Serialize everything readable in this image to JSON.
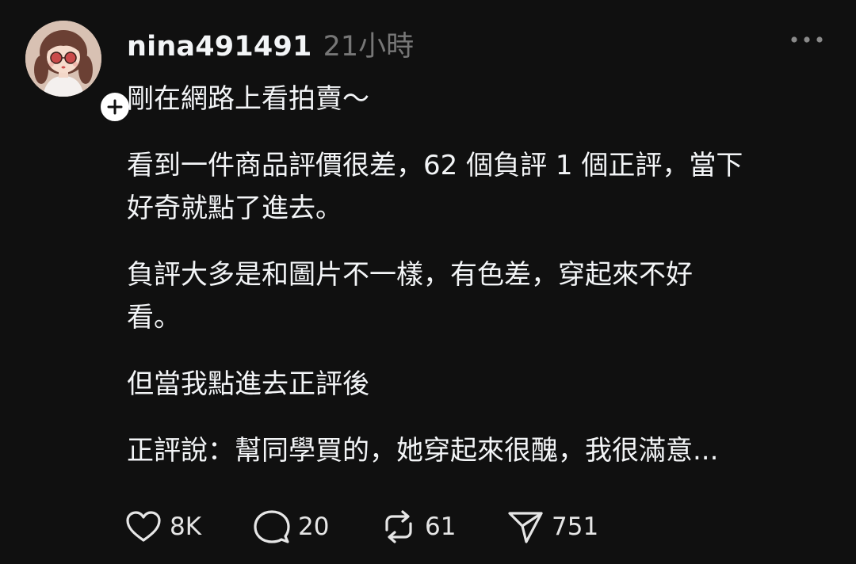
{
  "post": {
    "author": {
      "username": "nina491491",
      "avatar_icon": "cartoon-girl-avatar",
      "follow_icon": "plus-icon"
    },
    "timestamp": "21小時",
    "menu_icon": "more-horizontal-icon",
    "paragraphs": [
      "剛在網路上看拍賣～",
      "看到一件商品評價很差，62 個負評 1 個正評，當下",
      "好奇就點了進去。",
      "負評大多是和圖片不一樣，有色差，穿起來不好",
      "看。",
      "但當我點進去正評後",
      "正評說：幫同學買的，她穿起來很醜，我很滿意..."
    ],
    "actions": {
      "like": {
        "icon": "heart-icon",
        "count": "8K"
      },
      "reply": {
        "icon": "comment-icon",
        "count": "20"
      },
      "repost": {
        "icon": "repost-icon",
        "count": "61"
      },
      "share": {
        "icon": "send-icon",
        "count": "751"
      }
    }
  },
  "colors": {
    "background": "#101010",
    "text": "#f3f5f7",
    "muted": "#777777"
  }
}
